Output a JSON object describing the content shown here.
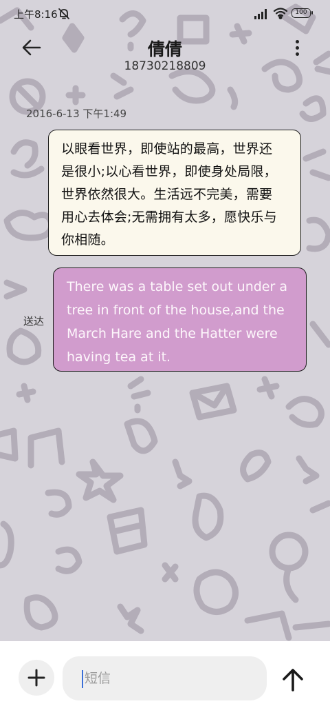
{
  "status_bar": {
    "time": "上午8:16",
    "battery": "100"
  },
  "header": {
    "title": "倩倩",
    "phone": "18730218809"
  },
  "messages": {
    "timestamp": "2016-6-13 下午1:49",
    "incoming_lines": [
      "以眼看世界，即使站的最高，世界还",
      "是很小;以心看世界，即使身处局限，",
      "世界依然很大。生活远不完美，需要",
      "用心去体会;无需拥有太多，愿快乐与",
      "你相随。"
    ],
    "outgoing_lines": [
      "There was a table set out under a",
      "tree in front of the house,and the",
      "March Hare and the Hatter were",
      "having tea at it."
    ],
    "delivered_label": "送达"
  },
  "composer": {
    "placeholder": "短信"
  },
  "icons": {
    "back": "arrow-left-icon",
    "more": "more-vertical-icon",
    "add": "plus-icon",
    "send": "arrow-up-icon",
    "dnd": "bell-off-icon",
    "signal": "signal-icon",
    "wifi": "wifi-icon"
  },
  "colors": {
    "incoming_bubble": "#fbf8ec",
    "outgoing_bubble": "#d19ccd",
    "background": "#d6d3da",
    "caret": "#3a6fd8"
  }
}
